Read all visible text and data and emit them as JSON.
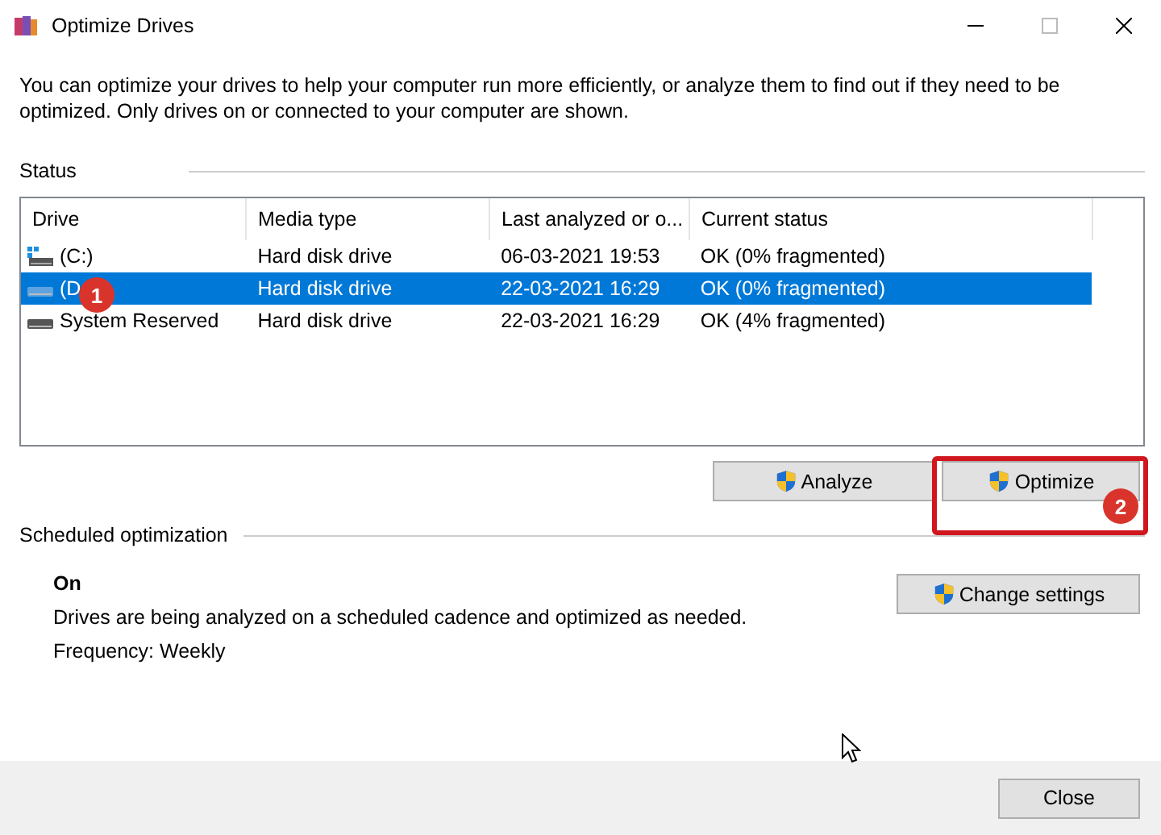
{
  "window": {
    "title": "Optimize Drives"
  },
  "description": "You can optimize your drives to help your computer run more efficiently, or analyze them to find out if they need to be optimized. Only drives on or connected to your computer are shown.",
  "status": {
    "label": "Status",
    "table": {
      "columns": [
        "Drive",
        "Media type",
        "Last analyzed or o...",
        "Current status"
      ],
      "rows": [
        {
          "drive": "(C:)",
          "kind": "system",
          "media_type": "Hard disk drive",
          "last_analyzed": "06-03-2021 19:53",
          "current_status": "OK (0% fragmented)",
          "selected": false
        },
        {
          "drive": "(D",
          "kind": "data",
          "media_type": "Hard disk drive",
          "last_analyzed": "22-03-2021 16:29",
          "current_status": "OK (0% fragmented)",
          "selected": true
        },
        {
          "drive": "System Reserved",
          "kind": "data",
          "media_type": "Hard disk drive",
          "last_analyzed": "22-03-2021 16:29",
          "current_status": "OK (4% fragmented)",
          "selected": false
        }
      ]
    },
    "buttons": [
      "Analyze",
      "Optimize"
    ]
  },
  "scheduled": {
    "label": "Scheduled optimization",
    "state": "On",
    "description": "Drives are being analyzed on a scheduled cadence and optimized as needed.",
    "frequency": "Frequency: Weekly",
    "button": "Change settings"
  },
  "footer": {
    "button": "Close"
  },
  "annotations": [
    {
      "label": "1"
    },
    {
      "label": "2"
    }
  ]
}
